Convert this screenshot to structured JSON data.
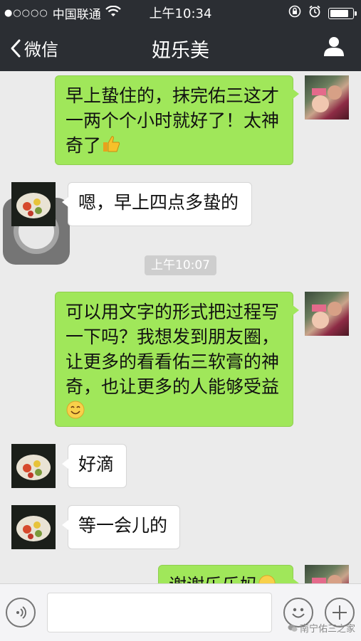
{
  "status_bar": {
    "signal_dots": "●○○○○",
    "carrier": "中国联通",
    "time": "上午10:34",
    "battery_level": 0.9
  },
  "nav": {
    "back_label": "微信",
    "title": "妞乐美"
  },
  "messages": [
    {
      "from": "me",
      "text": "早上蛰住的，抹完佑三这才一两个个小时就好了！太神奇了",
      "emoji": "thumbs-up"
    },
    {
      "from": "other",
      "text": "嗯，早上四点多蛰的"
    },
    {
      "from": "me",
      "text": "可以用文字的形式把过程写一下吗？我想发到朋友圈，让更多的看看佑三软膏的神奇，也让更多的人能够受益",
      "emoji": "smile"
    },
    {
      "from": "other",
      "text": "好滴"
    },
    {
      "from": "other",
      "text": "等一会儿的"
    },
    {
      "from": "me",
      "text": "谢谢乐乐妈",
      "emoji": "smile"
    }
  ],
  "timestamp": "上午10:07",
  "watermark": "南宁佑三之家",
  "colors": {
    "header_bg": "#2b2e33",
    "chat_bg": "#ebebeb",
    "my_bubble": "#a0e75a",
    "other_bubble": "#ffffff"
  }
}
